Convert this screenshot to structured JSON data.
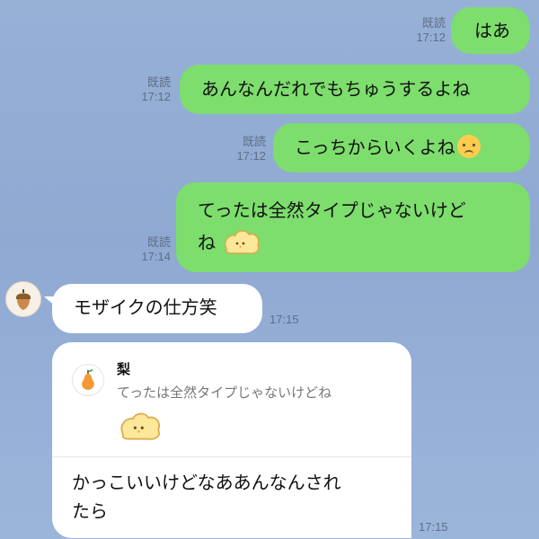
{
  "messages": [
    {
      "read": "既読",
      "time": "17:12",
      "text": "はあ"
    },
    {
      "read": "既読",
      "time": "17:12",
      "text": "あんなんだれでもちゅうするよね"
    },
    {
      "read": "既読",
      "time": "17:12",
      "text": "こっちからいくよね",
      "emoji": "disappointed-face-icon"
    },
    {
      "read": "既読",
      "time": "17:14",
      "line1": "てったは全然タイプじゃないけど",
      "line2": "ね",
      "sticker": "chick-sticker-icon"
    },
    {
      "time": "17:15",
      "text": "モザイクの仕方笑",
      "avatar": "acorn-avatar-icon"
    },
    {
      "time": "17:15",
      "quote": {
        "name": "梨",
        "text": "てったは全然タイプじゃないけどね",
        "avatar": "pear-avatar-icon",
        "sticker": "chick-sticker-icon"
      },
      "line1": "かっこいいけどなああんなんされ",
      "line2": "たら"
    }
  ],
  "colors": {
    "sent_bubble": "#7ddd6d",
    "received_bubble": "#ffffff",
    "background": "#93acd4"
  }
}
